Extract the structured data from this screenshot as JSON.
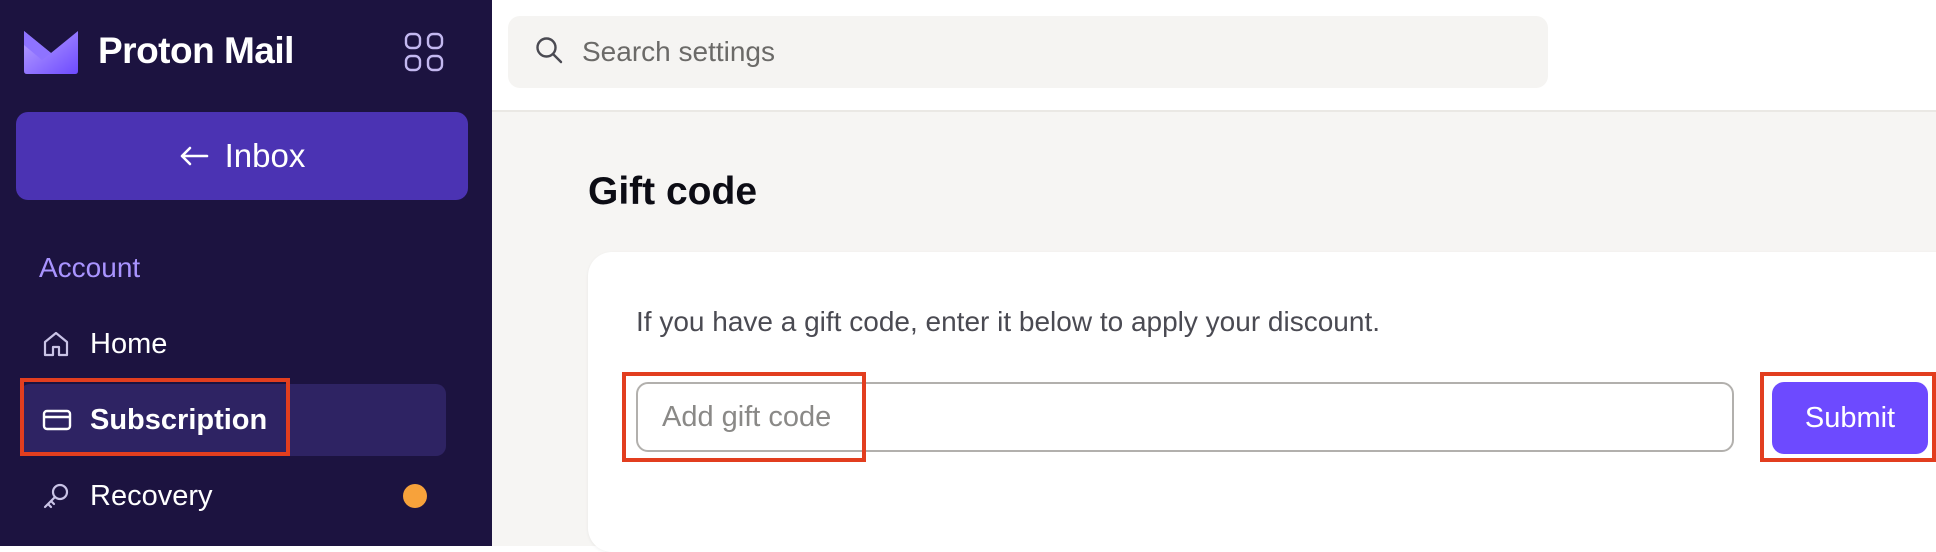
{
  "app": {
    "brand": "Proton Mail",
    "logo_icon": "proton-mail-logo-icon",
    "apps_icon": "grid-apps-icon"
  },
  "sidebar": {
    "back_button": {
      "label": "Inbox",
      "icon": "arrow-left-icon"
    },
    "section_label": "Account",
    "items": [
      {
        "label": "Home",
        "icon": "home-icon",
        "active": false
      },
      {
        "label": "Subscription",
        "icon": "credit-card-icon",
        "active": true
      },
      {
        "label": "Recovery",
        "icon": "key-icon",
        "active": false,
        "badge_color": "#f7a23b"
      }
    ]
  },
  "header": {
    "search": {
      "placeholder": "Search settings",
      "value": "",
      "icon": "search-icon"
    }
  },
  "main": {
    "title": "Gift code",
    "description": "If you have a gift code, enter it below to apply your discount.",
    "gift_input": {
      "placeholder": "Add gift code",
      "value": ""
    },
    "submit_label": "Submit"
  },
  "colors": {
    "sidebar_bg": "#1c1340",
    "accent": "#6d4aff",
    "inbox_button": "#4b33b3",
    "highlight_box": "#e23e1f"
  }
}
